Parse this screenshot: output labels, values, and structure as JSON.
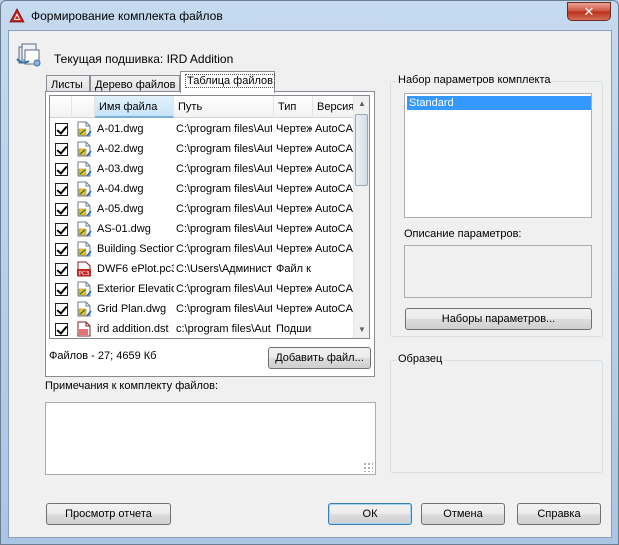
{
  "window": {
    "title": "Формирование комплекта файлов",
    "close_label": "✕"
  },
  "current_sheetset": "Текущая подшивка: IRD Addition",
  "tabs": [
    {
      "label": "Листы",
      "active": false
    },
    {
      "label": "Дерево файлов",
      "active": false
    },
    {
      "label": "Таблица файлов",
      "active": true
    }
  ],
  "file_table": {
    "columns": [
      "Имя файла",
      "Путь",
      "Тип",
      "Версия"
    ],
    "sorted_column": "Имя файла",
    "rows": [
      {
        "name": "A-01.dwg",
        "path": "C:\\program files\\Aut",
        "type": "Чертеж",
        "version": "AutoCAD",
        "icon": "dwg-file-icon"
      },
      {
        "name": "A-02.dwg",
        "path": "C:\\program files\\Aut",
        "type": "Чертеж",
        "version": "AutoCAD",
        "icon": "dwg-file-icon"
      },
      {
        "name": "A-03.dwg",
        "path": "C:\\program files\\Aut",
        "type": "Чертеж",
        "version": "AutoCAD",
        "icon": "dwg-file-icon"
      },
      {
        "name": "A-04.dwg",
        "path": "C:\\program files\\Aut",
        "type": "Чертеж",
        "version": "AutoCAD",
        "icon": "dwg-file-icon"
      },
      {
        "name": "A-05.dwg",
        "path": "C:\\program files\\Aut",
        "type": "Чертеж",
        "version": "AutoCAD",
        "icon": "dwg-file-icon"
      },
      {
        "name": "AS-01.dwg",
        "path": "C:\\program files\\Aut",
        "type": "Чертеж",
        "version": "AutoCAD",
        "icon": "dwg-file-icon"
      },
      {
        "name": "Building Section",
        "path": "C:\\program files\\Aut",
        "type": "Чертеж",
        "version": "AutoCAD",
        "icon": "dwg-file-icon"
      },
      {
        "name": "DWF6 ePlot.pc3",
        "path": "C:\\Users\\Админист",
        "type": "Файл к",
        "version": "",
        "icon": "pc3-file-icon"
      },
      {
        "name": "Exterior Elevatio",
        "path": "C:\\program files\\Aut",
        "type": "Чертеж",
        "version": "AutoCAD",
        "icon": "dwg-file-icon"
      },
      {
        "name": "Grid Plan.dwg",
        "path": "C:\\program files\\Aut",
        "type": "Чертеж",
        "version": "AutoCAD",
        "icon": "dwg-file-icon"
      },
      {
        "name": "ird addition.dst",
        "path": "c:\\program files\\Aut",
        "type": "Подшив",
        "version": "",
        "icon": "dst-file-icon"
      }
    ]
  },
  "files_summary": "Файлов - 27; 4659 Кб",
  "add_file_button": "Добавить файл...",
  "notes_label": "Примечания к комплекту файлов:",
  "notes_value": "",
  "param_group": {
    "title": "Набор параметров комплекта",
    "items": [
      "Standard"
    ],
    "selected": "Standard",
    "description_label": "Описание параметров:",
    "description_value": "",
    "sets_button": "Наборы параметров..."
  },
  "preview_group": {
    "title": "Образец"
  },
  "footer": {
    "report_button": "Просмотр отчета",
    "ok_button": "ОК",
    "cancel_button": "Отмена",
    "help_button": "Справка"
  },
  "colors": {
    "selection": "#3399ff",
    "sorted_header": "#c6e4f7",
    "close_button": "#c7432f"
  }
}
